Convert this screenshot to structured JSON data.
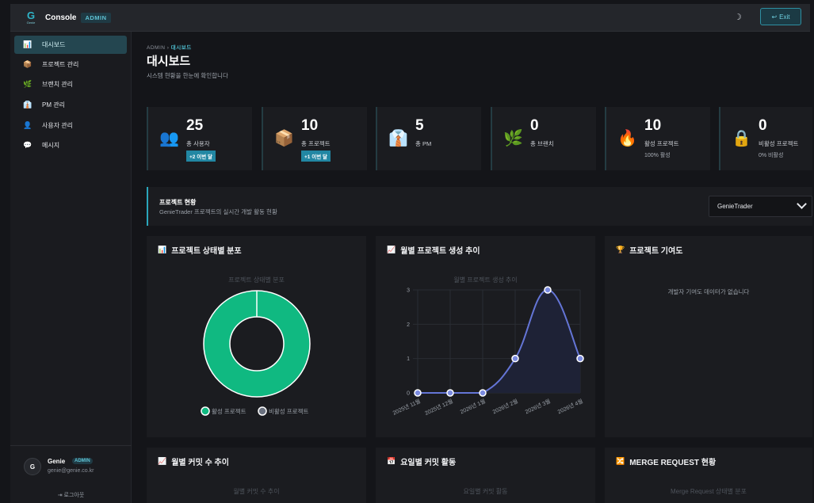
{
  "header": {
    "logo_letter": "G",
    "logo_sub": "Genie",
    "brand": "Console",
    "badge": "ADMIN",
    "exit_label": "Exit"
  },
  "sidebar": {
    "items": [
      {
        "icon": "📊",
        "label": "대시보드",
        "active": true
      },
      {
        "icon": "📦",
        "label": "프로젝트 관리"
      },
      {
        "icon": "🌿",
        "label": "브랜치 관리"
      },
      {
        "icon": "👔",
        "label": "PM 관리"
      },
      {
        "icon": "👤",
        "label": "사용자 관리"
      },
      {
        "icon": "💬",
        "label": "메시지"
      }
    ],
    "user": {
      "initial": "G",
      "name": "Genie",
      "badge": "ADMIN",
      "email": "genie@genie.co.kr",
      "logout_label": "로그아웃"
    }
  },
  "page": {
    "breadcrumb_root": "ADMIN",
    "breadcrumb_sep": "›",
    "breadcrumb_current": "대시보드",
    "title": "대시보드",
    "subtitle": "시스템 현황을 한눈에 확인합니다"
  },
  "stats": [
    {
      "icon": "👥",
      "value": "25",
      "label": "총 사용자",
      "tag": "+2 이번 달"
    },
    {
      "icon": "📦",
      "value": "10",
      "label": "총 프로젝트",
      "tag": "+1 이번 달"
    },
    {
      "icon": "👔",
      "value": "5",
      "label": "총 PM"
    },
    {
      "icon": "🌿",
      "value": "0",
      "label": "총 브랜치"
    },
    {
      "icon": "🔥",
      "value": "10",
      "label": "활성 프로젝트",
      "sub": "100% 활성"
    },
    {
      "icon": "🔒",
      "value": "0",
      "label": "비활성 프로젝트",
      "sub": "0% 비활성"
    }
  ],
  "project_status": {
    "title": "프로젝트 현황",
    "subtitle": "GenieTrader 프로젝트의 실시간 개발 활동 현황",
    "selected": "GenieTrader"
  },
  "cards": {
    "status_dist": {
      "icon": "📊",
      "title": "프로젝트 상태별 분포",
      "chart_title": "프로젝트 상태별 분포"
    },
    "monthly_creation": {
      "icon": "📈",
      "title": "월별 프로젝트 생성 추이",
      "chart_title": "월별 프로젝트 생성 추이"
    },
    "contribution": {
      "icon": "🏆",
      "title": "프로젝트 기여도",
      "empty": "개발자 기여도 데이터가 없습니다"
    },
    "monthly_commits": {
      "icon": "📈",
      "title": "월별 커밋 수 추이",
      "chart_title": "월별 커밋 수 추이"
    },
    "weekday_commits": {
      "icon": "📅",
      "title": "요일별 커밋 활동",
      "chart_title": "요일별 커밋 활동"
    },
    "merge_requests": {
      "icon": "🔀",
      "title": "MERGE REQUEST 현황",
      "chart_title": "Merge Request 상태별 분포"
    }
  },
  "chart_data": [
    {
      "type": "pie",
      "title": "프로젝트 상태별 분포",
      "categories": [
        "활성 프로젝트",
        "비활성 프로젝트"
      ],
      "values": [
        10,
        0
      ],
      "colors": [
        "#10b981",
        "#6b7280"
      ],
      "legend": "bottom"
    },
    {
      "type": "line",
      "title": "월별 프로젝트 생성 추이",
      "categories": [
        "2025년 11월",
        "2025년 12월",
        "2026년 1월",
        "2026년 2월",
        "2026년 3월",
        "2026년 4월"
      ],
      "values": [
        0,
        0,
        0,
        1,
        3,
        1
      ],
      "ylim": [
        0,
        3
      ],
      "yticks": [
        0,
        1,
        2,
        3
      ],
      "color": "#6475d6",
      "grid": true
    }
  ]
}
